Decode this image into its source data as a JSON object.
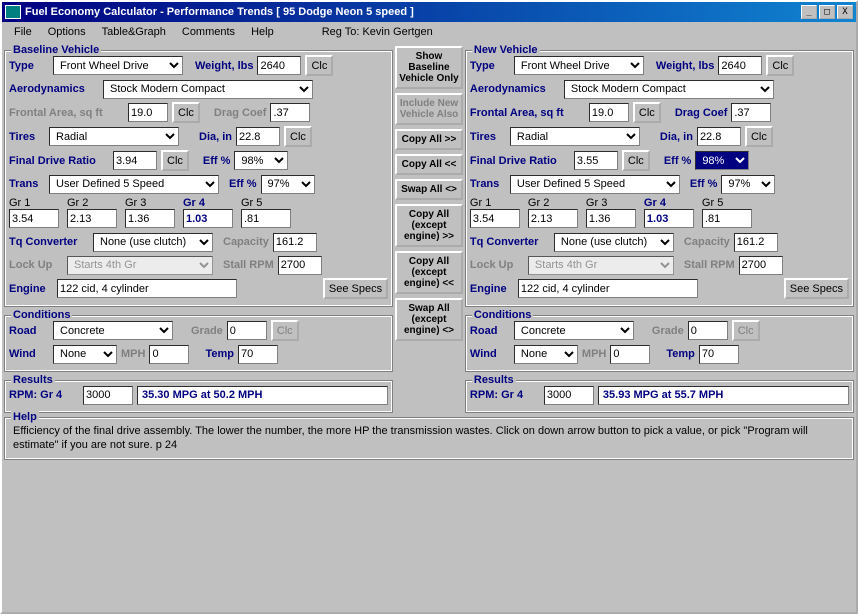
{
  "title": "Fuel Economy Calculator - Performance Trends    [ 95 Dodge Neon 5 speed ]",
  "menu": {
    "file": "File",
    "options": "Options",
    "tablegraph": "Table&Graph",
    "comments": "Comments",
    "help": "Help",
    "reg": "Reg To: Kevin Gertgen"
  },
  "btn": {
    "clc": "Clc",
    "seespecs": "See Specs"
  },
  "mid": {
    "show_baseline": "Show Baseline Vehicle Only",
    "include_new": "Include New Vehicle Also",
    "copy_all_right": "Copy All >>",
    "copy_all_left": "Copy All <<",
    "swap_all": "Swap All <>",
    "copy_except_right": "Copy All (except engine) >>",
    "copy_except_left": "Copy All (except engine) <<",
    "swap_except": "Swap All (except engine) <>"
  },
  "labels": {
    "type": "Type",
    "weight": "Weight, lbs",
    "aero": "Aerodynamics",
    "frontal": "Frontal Area, sq ft",
    "dragcoef": "Drag Coef",
    "tires": "Tires",
    "dia": "Dia, in",
    "fdr": "Final Drive Ratio",
    "eff": "Eff %",
    "trans": "Trans",
    "gr1": "Gr 1",
    "gr2": "Gr 2",
    "gr3": "Gr 3",
    "gr4": "Gr 4",
    "gr5": "Gr 5",
    "tqconv": "Tq Converter",
    "capacity": "Capacity",
    "lockup": "Lock Up",
    "stallrpm": "Stall RPM",
    "engine": "Engine",
    "road": "Road",
    "grade": "Grade",
    "wind": "Wind",
    "mph": "MPH",
    "temp": "Temp",
    "rpm": "RPM: Gr 4"
  },
  "baseline": {
    "legend": "Baseline Vehicle",
    "type": "Front Wheel Drive",
    "weight": "2640",
    "aero": "Stock Modern Compact",
    "frontal": "19.0",
    "dragcoef": ".37",
    "tires": "Radial",
    "dia": "22.8",
    "fdr": "3.94",
    "fdr_eff": "98%",
    "trans": "User Defined 5 Speed",
    "trans_eff": "97%",
    "gr1": "3.54",
    "gr2": "2.13",
    "gr3": "1.36",
    "gr4": "1.03",
    "gr5": ".81",
    "tqconv": "None (use clutch)",
    "capacity": "161.2",
    "lockup": "Starts 4th Gr",
    "stallrpm": "2700",
    "engine": "122 cid, 4 cylinder"
  },
  "new": {
    "legend": "New Vehicle",
    "type": "Front Wheel Drive",
    "weight": "2640",
    "aero": "Stock Modern Compact",
    "frontal": "19.0",
    "dragcoef": ".37",
    "tires": "Radial",
    "dia": "22.8",
    "fdr": "3.55",
    "fdr_eff": "98%",
    "trans": "User Defined 5 Speed",
    "trans_eff": "97%",
    "gr1": "3.54",
    "gr2": "2.13",
    "gr3": "1.36",
    "gr4": "1.03",
    "gr5": ".81",
    "tqconv": "None (use clutch)",
    "capacity": "161.2",
    "lockup": "Starts 4th Gr",
    "stallrpm": "2700",
    "engine": "122 cid, 4 cylinder"
  },
  "cond": {
    "legend": "Conditions",
    "road": "Concrete",
    "grade": "0",
    "wind": "None",
    "mph": "0",
    "temp": "70"
  },
  "results": {
    "legend": "Results",
    "baseline_rpm": "3000",
    "baseline_mpg": "35.30 MPG  at 50.2 MPH",
    "new_rpm": "3000",
    "new_mpg": "35.93 MPG  at 55.7 MPH"
  },
  "help": {
    "legend": "Help",
    "text": "Efficiency of the final drive assembly.  The lower the number, the more HP the transmission wastes.  Click on down arrow button to pick a value, or pick \"Program will estimate\" if you are not sure.   p 24"
  }
}
